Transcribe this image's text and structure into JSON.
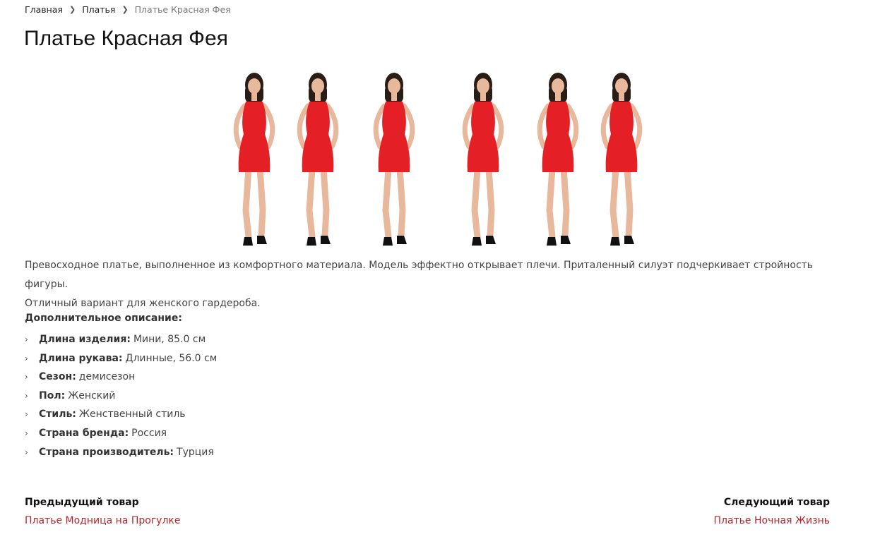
{
  "breadcrumb": {
    "home": "Главная",
    "category": "Платья",
    "current": "Платье Красная Фея"
  },
  "product": {
    "title": "Платье Красная Фея",
    "description_lines": [
      "Превосходное платье, выполненное из комфортного материала. Модель эффектно открывает плечи. Приталенный силуэт подчеркивает стройность фигуры.",
      "Отличный вариант для женского гардероба."
    ],
    "extra_title": "Дополнительное описание:",
    "attributes": [
      {
        "key": "Длина изделия:",
        "value": "Мини, 85.0 см"
      },
      {
        "key": "Длина рукава:",
        "value": "Длинные, 56.0 см"
      },
      {
        "key": "Сезон:",
        "value": "демисезон"
      },
      {
        "key": "Пол:",
        "value": "Женский"
      },
      {
        "key": "Стиль:",
        "value": "Женственный стиль"
      },
      {
        "key": "Страна бренда:",
        "value": "Россия"
      },
      {
        "key": "Страна производитель:",
        "value": "Турция"
      }
    ],
    "dress_color": "#e41f26"
  },
  "navigation": {
    "prev_label": "Предыдущий товар",
    "prev_link": "Платье Модница на Прогулке",
    "next_label": "Следующий товар",
    "next_link": "Платье Ночная Жизнь"
  },
  "colors": {
    "link": "#b5262a",
    "text": "#444444"
  }
}
